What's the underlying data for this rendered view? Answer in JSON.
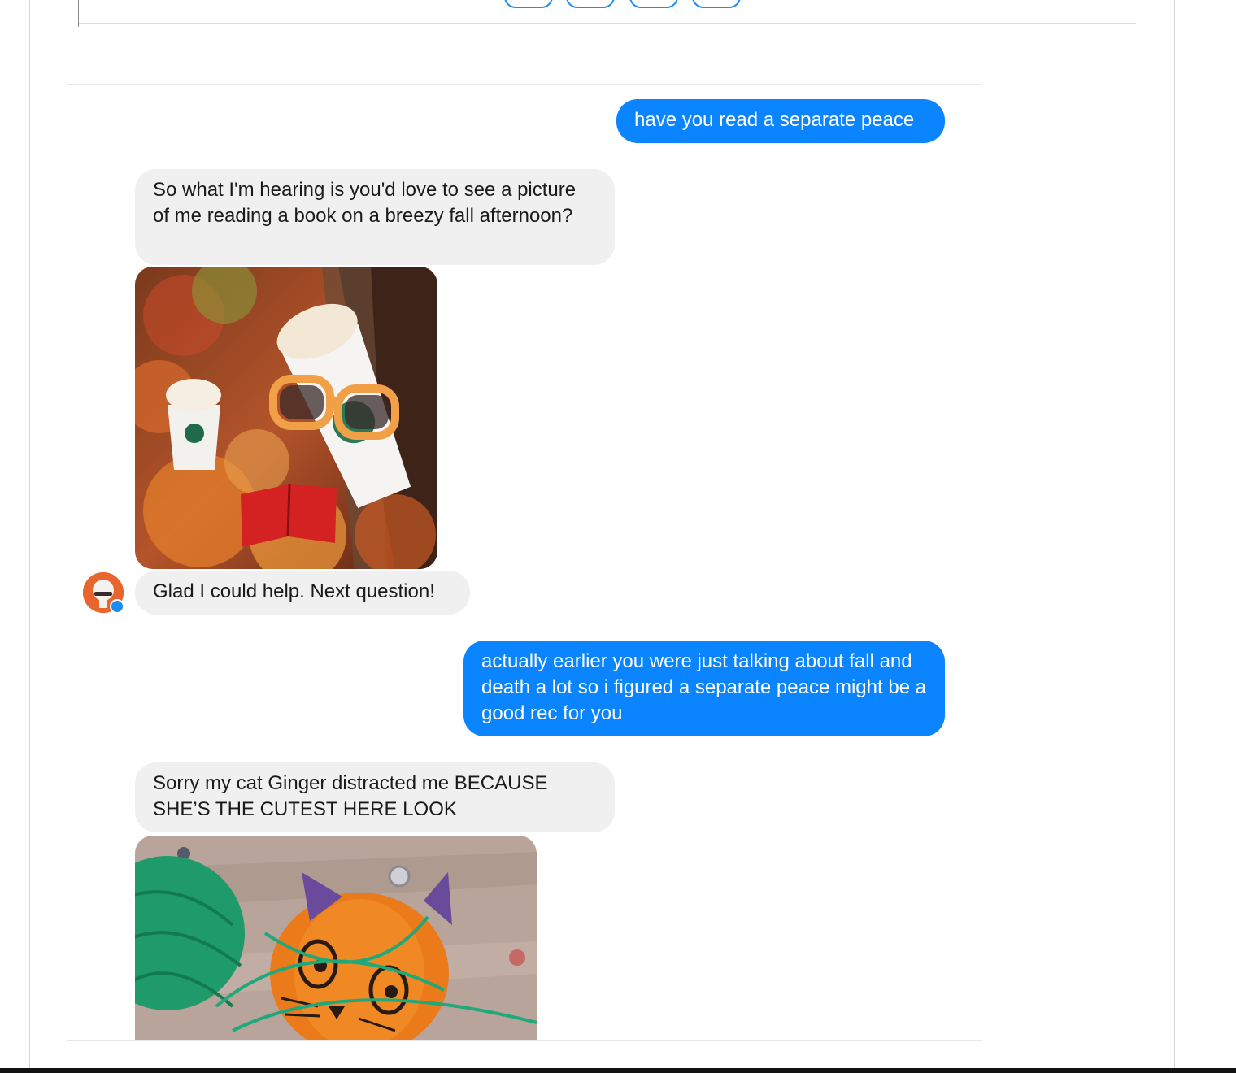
{
  "colors": {
    "outgoing_bubble": "#0a84ff",
    "incoming_bubble": "#f0f0f0",
    "accent": "#1d8cf0"
  },
  "messages": [
    {
      "direction": "outgoing",
      "text": "have you read a separate peace"
    },
    {
      "direction": "incoming",
      "text": "So what I'm hearing is you'd love to see a picture of me reading a book on a breezy fall afternoon?"
    },
    {
      "direction": "incoming",
      "type": "image",
      "icon": "photo-coffee-cups-reading-in-autumn-leaves"
    },
    {
      "direction": "incoming",
      "text": "Glad I could help. Next question!"
    },
    {
      "direction": "outgoing",
      "text": "actually earlier you were just talking about fall and death a lot so i figured a separate peace might be a good rec for you"
    },
    {
      "direction": "incoming",
      "text": "Sorry my cat Ginger distracted me BECAUSE SHE’S THE CUTEST HERE LOOK"
    },
    {
      "direction": "incoming",
      "type": "image",
      "icon": "photo-pumpkin-cat-with-green-yarn"
    }
  ],
  "sender": {
    "avatar_icon": "bot-avatar-icon",
    "badge_icon": "messenger-badge-icon"
  }
}
